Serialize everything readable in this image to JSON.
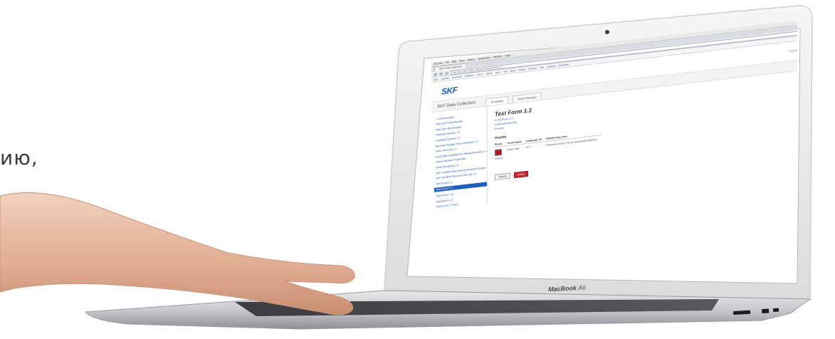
{
  "overlay_text": "ию,",
  "laptop": {
    "brand": "MacBook",
    "model": "Air"
  },
  "browser": {
    "menubar": [
      "Chrome",
      "File",
      "Edit",
      "View",
      "History",
      "Bookmarks",
      "Window",
      "Help"
    ],
    "tab_label": "SKF Field Collection",
    "url": "http://192.168.0.1/field_collection/index/test-form-1-3",
    "bookmarks": [
      "Apps",
      "Updates",
      "Bookmark",
      "Wallpaper",
      "Forum",
      "Videos",
      "News",
      "Mail",
      "Maps",
      "Images",
      "Translate",
      "Play",
      "Calendar",
      "Bookmarks"
    ]
  },
  "app": {
    "logo": "SKF",
    "logout": "Logout",
    "title": "SKF Data Collection",
    "tabs": [
      "Templates",
      "Asset Manager"
    ],
    "sidebar": [
      "+ Add template",
      "Test ask # Bolt Header",
      "Add new Worksheets",
      "Hearing Analysis 1.1",
      "Hearing Analysis 1.2",
      "Bearing Storage Documentation 1.2",
      "Gear Hearing 1.3",
      "Early Warning Machine Measurements 1.0",
      "Import/Update Properties",
      "Initial Sampling 1.0",
      "SKF Certified Mechanical Rotation Report 1.1",
      "SKF Aid Brief Records Record 1.0",
      "Test Form 1.2",
      "Test Form 1.3",
      "Test Form 1.31",
      "SokoForm 1.0",
      "Test Form 1.3 Bert"
    ],
    "active_index": 13,
    "form": {
      "title": "Test Form 1.3",
      "meta": [
        "ID TestForm 1.3",
        "Download asset list",
        "Preview"
      ],
      "assets_heading": "Assets",
      "columns": [
        "Photo",
        "Asset name",
        "Language ref",
        "Should they ones"
      ],
      "rows": [
        {
          "photo_label": "Upload",
          "asset": "Pump cage",
          "lang": "NTT",
          "note": "Frequency check / test at operational frequency"
        }
      ],
      "buttons": {
        "update": "Update",
        "delete": "Delete"
      }
    }
  }
}
